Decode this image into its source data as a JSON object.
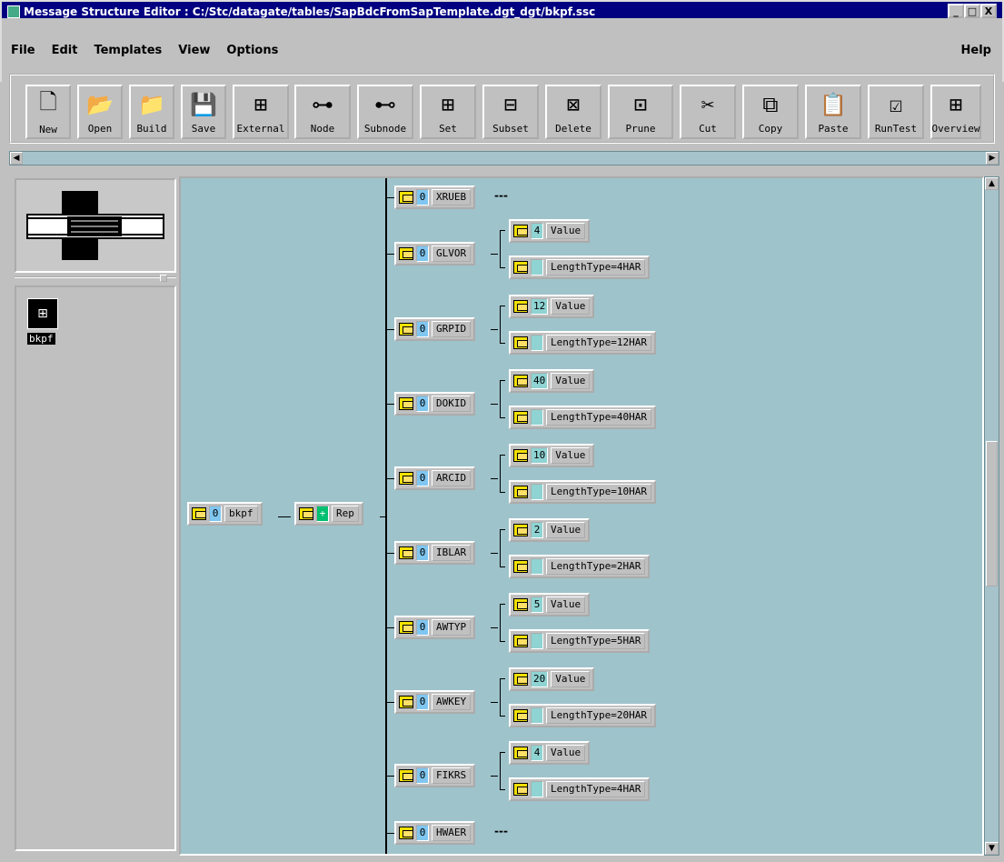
{
  "window": {
    "title": "Message Structure Editor : C:/Stc/datagate/tables/SapBdcFromSapTemplate.dgt_dgt/bkpf.ssc",
    "btn_min": "_",
    "btn_max": "□",
    "btn_close": "X"
  },
  "menu": {
    "items": [
      "File",
      "Edit",
      "Templates",
      "View",
      "Options"
    ],
    "help": "Help"
  },
  "toolbar": {
    "buttons": [
      {
        "label": "New",
        "icon": "new-file-icon"
      },
      {
        "label": "Open",
        "icon": "open-folder-icon"
      },
      {
        "label": "Build",
        "icon": "build-icon"
      },
      {
        "label": "Save",
        "icon": "save-icon"
      },
      {
        "label": "External",
        "icon": "external-icon"
      },
      {
        "label": "Node",
        "icon": "node-icon"
      },
      {
        "label": "Subnode",
        "icon": "subnode-icon"
      },
      {
        "label": "Set",
        "icon": "set-icon"
      },
      {
        "label": "Subset",
        "icon": "subset-icon"
      },
      {
        "label": "Delete",
        "icon": "delete-icon"
      },
      {
        "label": "Prune",
        "icon": "prune-icon"
      },
      {
        "label": "Cut",
        "icon": "cut-icon"
      },
      {
        "label": "Copy",
        "icon": "copy-icon"
      },
      {
        "label": "Paste",
        "icon": "paste-icon"
      },
      {
        "label": "RunTest",
        "icon": "runtest-icon"
      },
      {
        "label": "Overview",
        "icon": "overview-icon"
      }
    ]
  },
  "filepane": {
    "file_label": "bkpf"
  },
  "tree": {
    "root": {
      "count": "0",
      "name": "bkpf"
    },
    "rep": {
      "count": "+",
      "name": "Rep"
    },
    "fields": [
      {
        "count": "0",
        "name": "XRUEB",
        "trail": "---",
        "children": []
      },
      {
        "count": "0",
        "name": "GLVOR",
        "children": [
          {
            "count": "4",
            "name": "Value"
          },
          {
            "count": "",
            "name": "LengthType=4HAR"
          }
        ]
      },
      {
        "count": "0",
        "name": "GRPID",
        "children": [
          {
            "count": "12",
            "name": "Value"
          },
          {
            "count": "",
            "name": "LengthType=12HAR"
          }
        ]
      },
      {
        "count": "0",
        "name": "DOKID",
        "children": [
          {
            "count": "40",
            "name": "Value"
          },
          {
            "count": "",
            "name": "LengthType=40HAR"
          }
        ]
      },
      {
        "count": "0",
        "name": "ARCID",
        "children": [
          {
            "count": "10",
            "name": "Value"
          },
          {
            "count": "",
            "name": "LengthType=10HAR"
          }
        ]
      },
      {
        "count": "0",
        "name": "IBLAR",
        "children": [
          {
            "count": "2",
            "name": "Value"
          },
          {
            "count": "",
            "name": "LengthType=2HAR"
          }
        ]
      },
      {
        "count": "0",
        "name": "AWTYP",
        "children": [
          {
            "count": "5",
            "name": "Value"
          },
          {
            "count": "",
            "name": "LengthType=5HAR"
          }
        ]
      },
      {
        "count": "0",
        "name": "AWKEY",
        "children": [
          {
            "count": "20",
            "name": "Value"
          },
          {
            "count": "",
            "name": "LengthType=20HAR"
          }
        ]
      },
      {
        "count": "0",
        "name": "FIKRS",
        "children": [
          {
            "count": "4",
            "name": "Value"
          },
          {
            "count": "",
            "name": "LengthType=4HAR"
          }
        ]
      },
      {
        "count": "0",
        "name": "HWAER",
        "trail": "---",
        "children": []
      }
    ]
  }
}
